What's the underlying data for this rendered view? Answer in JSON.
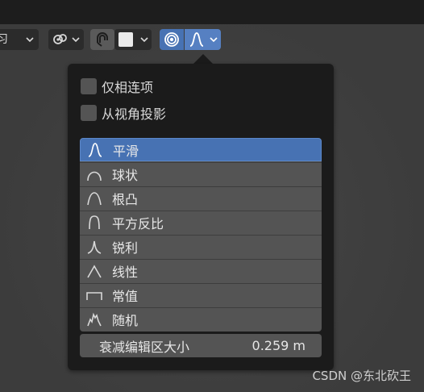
{
  "toolbar": {
    "colors": {
      "active": "#4772b3",
      "button": "#2b2b2b"
    },
    "items": [
      {
        "icon": "dropdown-chevron-icon"
      },
      {
        "icon": "link-chain-icon"
      },
      {
        "icon": "snap-magnet-icon"
      },
      {
        "icon": "white-square-icon"
      },
      {
        "icon": "proportional-edit-icon",
        "active": true
      },
      {
        "icon": "smooth-falloff-icon",
        "active": true
      }
    ],
    "partial_text": "习"
  },
  "popup": {
    "checkboxes": [
      {
        "label": "仅相连项",
        "checked": false
      },
      {
        "label": "从视角投影",
        "checked": false
      }
    ],
    "falloff_options": [
      {
        "label": "平滑",
        "icon": "smooth-curve-icon",
        "selected": true
      },
      {
        "label": "球状",
        "icon": "sphere-curve-icon",
        "selected": false
      },
      {
        "label": "根凸",
        "icon": "root-curve-icon",
        "selected": false
      },
      {
        "label": "平方反比",
        "icon": "inverse-square-curve-icon",
        "selected": false
      },
      {
        "label": "锐利",
        "icon": "sharp-curve-icon",
        "selected": false
      },
      {
        "label": "线性",
        "icon": "linear-curve-icon",
        "selected": false
      },
      {
        "label": "常值",
        "icon": "constant-curve-icon",
        "selected": false
      },
      {
        "label": "随机",
        "icon": "random-curve-icon",
        "selected": false
      }
    ],
    "size_field": {
      "label": "衰减编辑区大小",
      "value": "0.259 m"
    }
  },
  "watermark": "CSDN @东北砍王"
}
